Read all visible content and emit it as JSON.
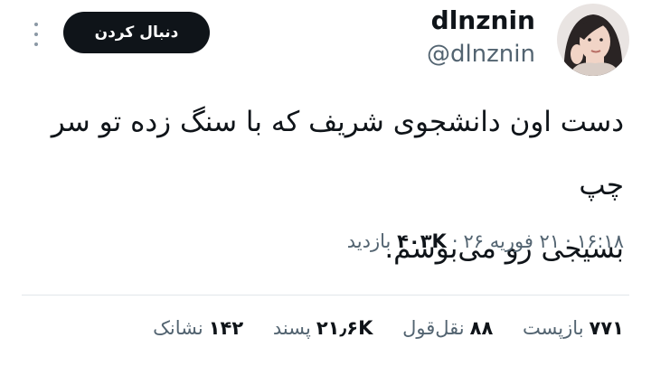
{
  "header": {
    "display_name": "dlnznin",
    "handle": "@dlnznin",
    "follow_label": "دنبال کردن",
    "more_icon": "more-horizontal-icon",
    "avatar_icon": "profile-avatar"
  },
  "tweet": {
    "line1": "دست اون دانشجوی شریف که با سنگ زده تو سر چپ",
    "line2": "بسیجی رو می‌بوسم."
  },
  "meta": {
    "time": "۱۶:۱۸",
    "date": "۲۱ فوریه ۲۶",
    "views_count": "۴۰۳K",
    "views_label": "بازدید"
  },
  "stats": {
    "reposts_count": "۷۷۱",
    "reposts_label": "بازپست",
    "quotes_count": "۸۸",
    "quotes_label": "نقل‌قول",
    "likes_count": "۲۱٫۶K",
    "likes_label": "پسند",
    "bookmarks_count": "۱۴۲",
    "bookmarks_label": "نشانک"
  },
  "colors": {
    "text_primary": "#0f1419",
    "text_secondary": "#536471",
    "button_bg": "#0f1419",
    "divider": "#e1e6ea"
  }
}
